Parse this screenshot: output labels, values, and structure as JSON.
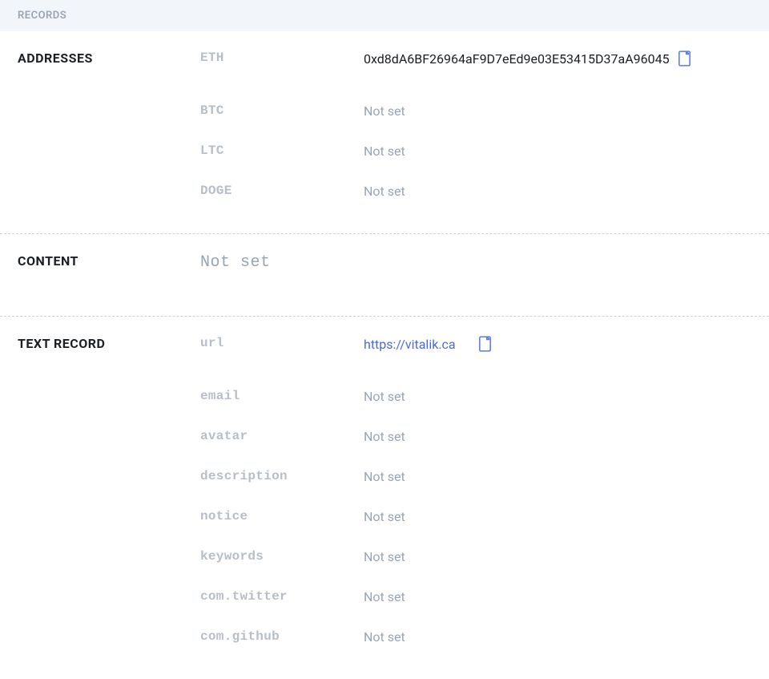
{
  "header": {
    "title": "RECORDS"
  },
  "sections": {
    "addresses": {
      "label": "ADDRESSES",
      "items": [
        {
          "key": "ETH",
          "value": "0xd8dA6BF26964aF9D7eEd9e03E53415D37aA96045",
          "hasCopy": true
        },
        {
          "key": "BTC",
          "value": "Not set",
          "notSet": true
        },
        {
          "key": "LTC",
          "value": "Not set",
          "notSet": true
        },
        {
          "key": "DOGE",
          "value": "Not set",
          "notSet": true
        }
      ]
    },
    "content": {
      "label": "CONTENT",
      "value": "Not set",
      "notSet": true
    },
    "textRecord": {
      "label": "TEXT RECORD",
      "items": [
        {
          "key": "url",
          "value": "https://vitalik.ca",
          "isLink": true,
          "hasCopy": true
        },
        {
          "key": "email",
          "value": "Not set",
          "notSet": true
        },
        {
          "key": "avatar",
          "value": "Not set",
          "notSet": true
        },
        {
          "key": "description",
          "value": "Not set",
          "notSet": true
        },
        {
          "key": "notice",
          "value": "Not set",
          "notSet": true
        },
        {
          "key": "keywords",
          "value": "Not set",
          "notSet": true
        },
        {
          "key": "com.twitter",
          "value": "Not set",
          "notSet": true
        },
        {
          "key": "com.github",
          "value": "Not set",
          "notSet": true
        }
      ]
    }
  }
}
